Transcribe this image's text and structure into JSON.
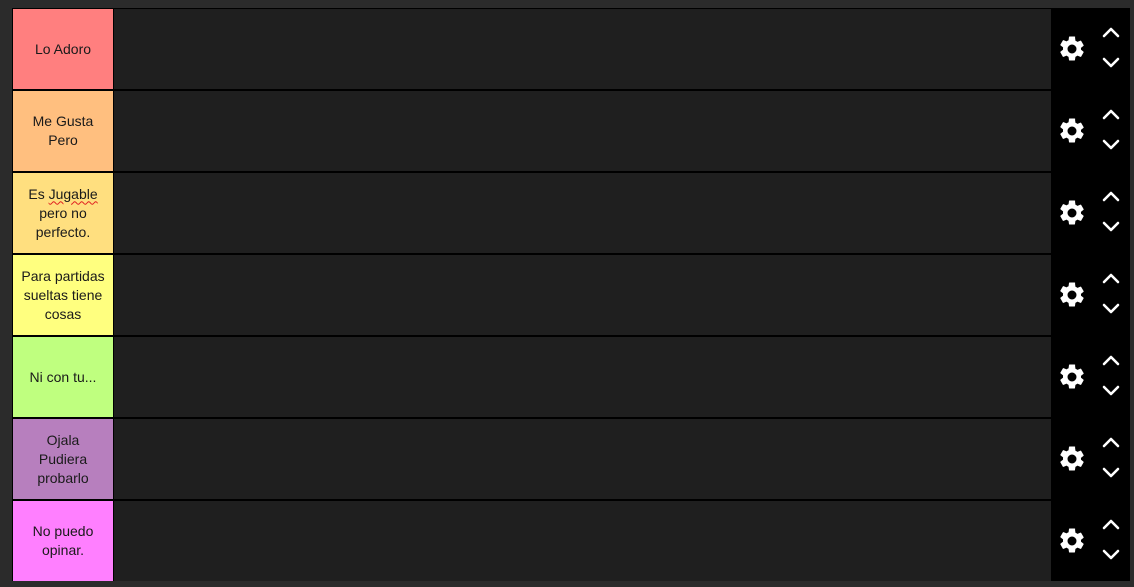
{
  "tiers": [
    {
      "lines": [
        "Lo Adoro"
      ],
      "color": "#ff7f7f"
    },
    {
      "lines": [
        "Me Gusta",
        "Pero"
      ],
      "color": "#ffbf7f"
    },
    {
      "lines_parts": {
        "l1a": "Es ",
        "l1b": "Jugable",
        "l2": "pero no",
        "l3": "perfecto."
      },
      "color": "#ffdf7f"
    },
    {
      "lines": [
        "Para partidas",
        "sueltas tiene",
        "cosas"
      ],
      "color": "#ffff7f"
    },
    {
      "lines": [
        "Ni con tu..."
      ],
      "color": "#bfff7f"
    },
    {
      "lines": [
        "Ojala",
        "Pudiera",
        "probarlo"
      ],
      "color": "#b77fbe"
    },
    {
      "lines": [
        "No puedo",
        "opinar."
      ],
      "color": "#ff7fff"
    }
  ],
  "icons": {
    "settings": "gear-icon",
    "move_up": "chevron-up-icon",
    "move_down": "chevron-down-icon"
  },
  "colors": {
    "background": "#2b2b2b",
    "row_area": "#1f1f1f",
    "controls": "#000000"
  }
}
